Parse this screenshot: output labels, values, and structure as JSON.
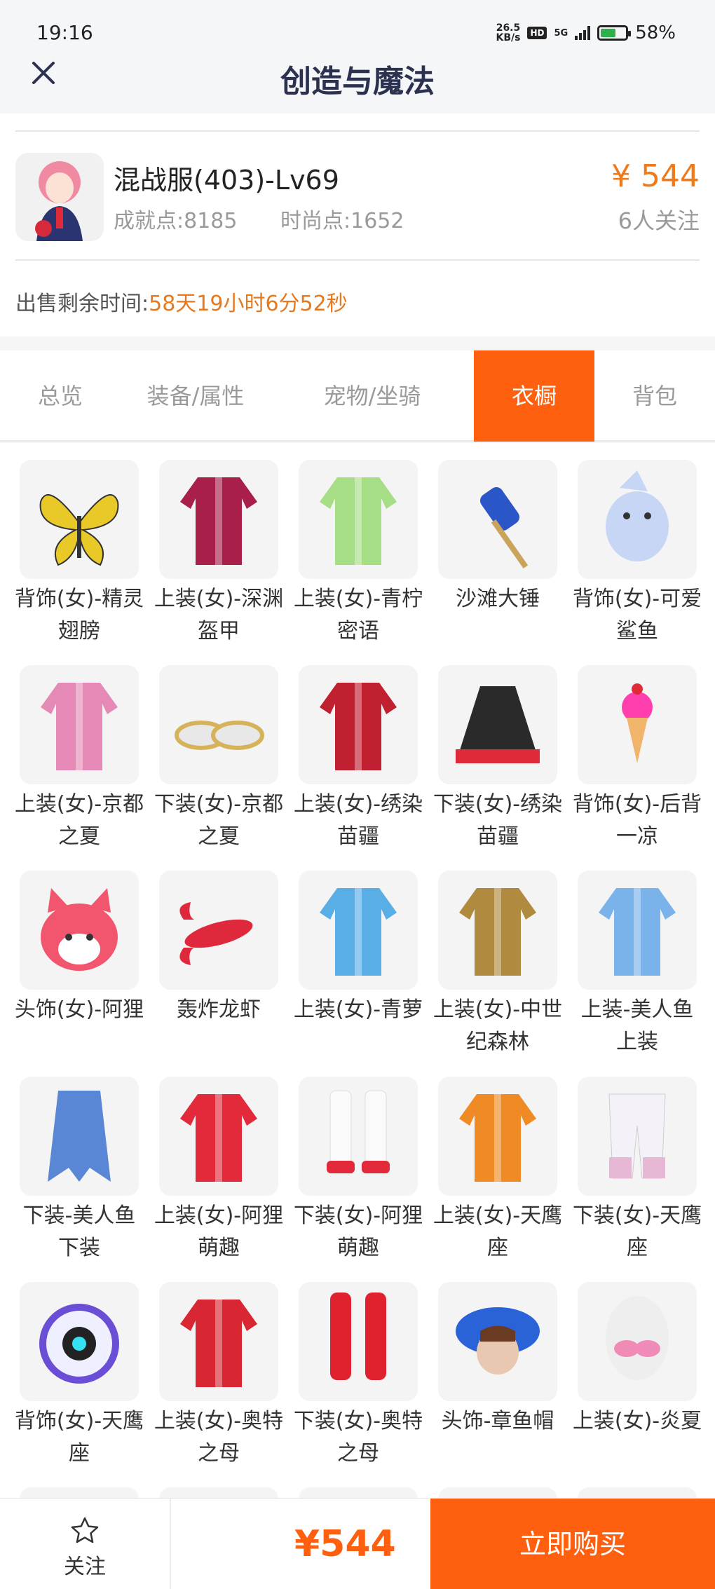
{
  "status_bar": {
    "time": "19:16",
    "net_speed_top": "26.5",
    "net_speed_bottom": "KB/s",
    "hd": "HD",
    "signal": "5G",
    "battery_level": 0.58,
    "battery": "58%"
  },
  "header": {
    "title": "创造与魔法",
    "back_icon": "close-icon"
  },
  "product": {
    "server": "混战服(403)-Lv69",
    "achievement": "成就点:8185",
    "fashion": "时尚点:1652",
    "price": "¥ 544",
    "followers": "6人关注",
    "remaining_label": "出售剩余时间:",
    "remaining_value": "58天19小时6分52秒"
  },
  "tabs": [
    {
      "label": "总览",
      "active": false
    },
    {
      "label": "装备/属性",
      "active": false
    },
    {
      "label": "宠物/坐骑",
      "active": false
    },
    {
      "label": "衣橱",
      "active": true
    },
    {
      "label": "背包",
      "active": false
    }
  ],
  "wardrobe": [
    {
      "name": "背饰(女)-精灵翅膀",
      "icon": "butterfly-wings-icon",
      "color": "#e8c928"
    },
    {
      "name": "上装(女)-深渊盔甲",
      "icon": "armor-icon",
      "color": "#a8204a"
    },
    {
      "name": "上装(女)-青柠密语",
      "icon": "dress-icon",
      "color": "#a6de86"
    },
    {
      "name": "沙滩大锤",
      "icon": "hammer-icon",
      "color": "#2a56c8"
    },
    {
      "name": "背饰(女)-可爱鲨鱼",
      "icon": "shark-icon",
      "color": "#c6d6f4"
    },
    {
      "name": "上装(女)-京都之夏",
      "icon": "kimono-icon",
      "color": "#e58ab6"
    },
    {
      "name": "下装(女)-京都之夏",
      "icon": "sandals-icon",
      "color": "#d6b25a"
    },
    {
      "name": "上装(女)-绣染苗疆",
      "icon": "embroidered-top-icon",
      "color": "#c02030"
    },
    {
      "name": "下装(女)-绣染苗疆",
      "icon": "skirt-icon",
      "color": "#2a2a2a"
    },
    {
      "name": "背饰(女)-后背一凉",
      "icon": "icecream-icon",
      "color": "#ff3fae"
    },
    {
      "name": "头饰(女)-阿狸",
      "icon": "fox-head-icon",
      "color": "#f2566e"
    },
    {
      "name": "轰炸龙虾",
      "icon": "lobster-icon",
      "color": "#e0283c"
    },
    {
      "name": "上装(女)-青萝",
      "icon": "dress-icon",
      "color": "#5aaee6"
    },
    {
      "name": "上装(女)-中世纪森林",
      "icon": "medieval-dress-icon",
      "color": "#b08a3e"
    },
    {
      "name": "上装-美人鱼上装",
      "icon": "mermaid-top-icon",
      "color": "#7ab2ea"
    },
    {
      "name": "下装-美人鱼下装",
      "icon": "mermaid-tail-icon",
      "color": "#5a86d6"
    },
    {
      "name": "上装(女)-阿狸萌趣",
      "icon": "hoodie-icon",
      "color": "#e22a3a"
    },
    {
      "name": "下装(女)-阿狸萌趣",
      "icon": "boots-icon",
      "color": "#e22a3a"
    },
    {
      "name": "上装(女)-天鹰座",
      "icon": "jacket-icon",
      "color": "#f08a24"
    },
    {
      "name": "下装(女)-天鹰座",
      "icon": "pants-icon",
      "color": "#e6b8d6"
    },
    {
      "name": "背饰(女)-天鹰座",
      "icon": "backpack-icon",
      "color": "#6a4ed6"
    },
    {
      "name": "上装(女)-奥特之母",
      "icon": "suit-top-icon",
      "color": "#d82632"
    },
    {
      "name": "下装(女)-奥特之母",
      "icon": "red-boots-icon",
      "color": "#e0222e"
    },
    {
      "name": "头饰-章鱼帽",
      "icon": "octopus-hat-icon",
      "color": "#2a62d8"
    },
    {
      "name": "上装(女)-炎夏",
      "icon": "bikini-top-icon",
      "color": "#f08ab6"
    }
  ],
  "bottom_bar": {
    "follow_label": "关注",
    "price": "¥544",
    "buy_label": "立即购买"
  }
}
